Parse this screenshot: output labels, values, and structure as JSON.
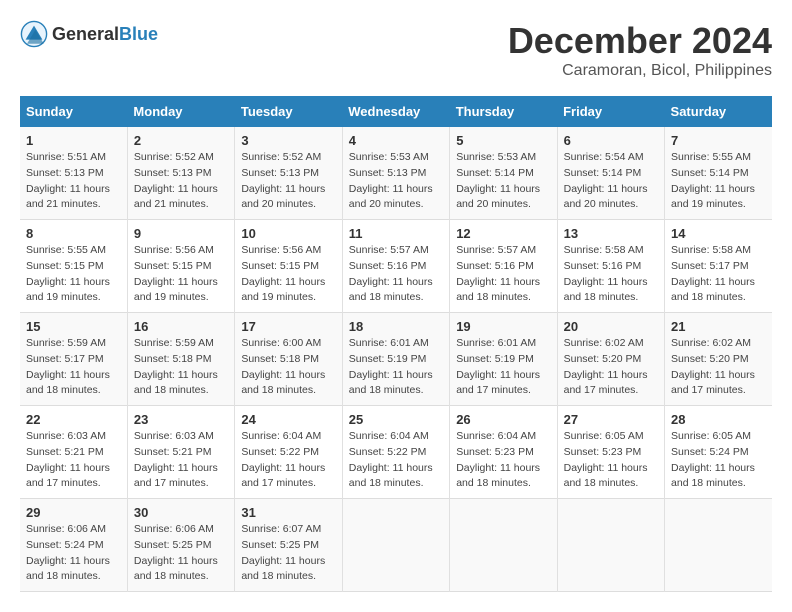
{
  "logo": {
    "text_general": "General",
    "text_blue": "Blue"
  },
  "title": "December 2024",
  "subtitle": "Caramoran, Bicol, Philippines",
  "headers": [
    "Sunday",
    "Monday",
    "Tuesday",
    "Wednesday",
    "Thursday",
    "Friday",
    "Saturday"
  ],
  "weeks": [
    [
      {
        "day": "1",
        "sunrise": "Sunrise: 5:51 AM",
        "sunset": "Sunset: 5:13 PM",
        "daylight": "Daylight: 11 hours and 21 minutes."
      },
      {
        "day": "2",
        "sunrise": "Sunrise: 5:52 AM",
        "sunset": "Sunset: 5:13 PM",
        "daylight": "Daylight: 11 hours and 21 minutes."
      },
      {
        "day": "3",
        "sunrise": "Sunrise: 5:52 AM",
        "sunset": "Sunset: 5:13 PM",
        "daylight": "Daylight: 11 hours and 20 minutes."
      },
      {
        "day": "4",
        "sunrise": "Sunrise: 5:53 AM",
        "sunset": "Sunset: 5:13 PM",
        "daylight": "Daylight: 11 hours and 20 minutes."
      },
      {
        "day": "5",
        "sunrise": "Sunrise: 5:53 AM",
        "sunset": "Sunset: 5:14 PM",
        "daylight": "Daylight: 11 hours and 20 minutes."
      },
      {
        "day": "6",
        "sunrise": "Sunrise: 5:54 AM",
        "sunset": "Sunset: 5:14 PM",
        "daylight": "Daylight: 11 hours and 20 minutes."
      },
      {
        "day": "7",
        "sunrise": "Sunrise: 5:55 AM",
        "sunset": "Sunset: 5:14 PM",
        "daylight": "Daylight: 11 hours and 19 minutes."
      }
    ],
    [
      {
        "day": "8",
        "sunrise": "Sunrise: 5:55 AM",
        "sunset": "Sunset: 5:15 PM",
        "daylight": "Daylight: 11 hours and 19 minutes."
      },
      {
        "day": "9",
        "sunrise": "Sunrise: 5:56 AM",
        "sunset": "Sunset: 5:15 PM",
        "daylight": "Daylight: 11 hours and 19 minutes."
      },
      {
        "day": "10",
        "sunrise": "Sunrise: 5:56 AM",
        "sunset": "Sunset: 5:15 PM",
        "daylight": "Daylight: 11 hours and 19 minutes."
      },
      {
        "day": "11",
        "sunrise": "Sunrise: 5:57 AM",
        "sunset": "Sunset: 5:16 PM",
        "daylight": "Daylight: 11 hours and 18 minutes."
      },
      {
        "day": "12",
        "sunrise": "Sunrise: 5:57 AM",
        "sunset": "Sunset: 5:16 PM",
        "daylight": "Daylight: 11 hours and 18 minutes."
      },
      {
        "day": "13",
        "sunrise": "Sunrise: 5:58 AM",
        "sunset": "Sunset: 5:16 PM",
        "daylight": "Daylight: 11 hours and 18 minutes."
      },
      {
        "day": "14",
        "sunrise": "Sunrise: 5:58 AM",
        "sunset": "Sunset: 5:17 PM",
        "daylight": "Daylight: 11 hours and 18 minutes."
      }
    ],
    [
      {
        "day": "15",
        "sunrise": "Sunrise: 5:59 AM",
        "sunset": "Sunset: 5:17 PM",
        "daylight": "Daylight: 11 hours and 18 minutes."
      },
      {
        "day": "16",
        "sunrise": "Sunrise: 5:59 AM",
        "sunset": "Sunset: 5:18 PM",
        "daylight": "Daylight: 11 hours and 18 minutes."
      },
      {
        "day": "17",
        "sunrise": "Sunrise: 6:00 AM",
        "sunset": "Sunset: 5:18 PM",
        "daylight": "Daylight: 11 hours and 18 minutes."
      },
      {
        "day": "18",
        "sunrise": "Sunrise: 6:01 AM",
        "sunset": "Sunset: 5:19 PM",
        "daylight": "Daylight: 11 hours and 18 minutes."
      },
      {
        "day": "19",
        "sunrise": "Sunrise: 6:01 AM",
        "sunset": "Sunset: 5:19 PM",
        "daylight": "Daylight: 11 hours and 17 minutes."
      },
      {
        "day": "20",
        "sunrise": "Sunrise: 6:02 AM",
        "sunset": "Sunset: 5:20 PM",
        "daylight": "Daylight: 11 hours and 17 minutes."
      },
      {
        "day": "21",
        "sunrise": "Sunrise: 6:02 AM",
        "sunset": "Sunset: 5:20 PM",
        "daylight": "Daylight: 11 hours and 17 minutes."
      }
    ],
    [
      {
        "day": "22",
        "sunrise": "Sunrise: 6:03 AM",
        "sunset": "Sunset: 5:21 PM",
        "daylight": "Daylight: 11 hours and 17 minutes."
      },
      {
        "day": "23",
        "sunrise": "Sunrise: 6:03 AM",
        "sunset": "Sunset: 5:21 PM",
        "daylight": "Daylight: 11 hours and 17 minutes."
      },
      {
        "day": "24",
        "sunrise": "Sunrise: 6:04 AM",
        "sunset": "Sunset: 5:22 PM",
        "daylight": "Daylight: 11 hours and 17 minutes."
      },
      {
        "day": "25",
        "sunrise": "Sunrise: 6:04 AM",
        "sunset": "Sunset: 5:22 PM",
        "daylight": "Daylight: 11 hours and 18 minutes."
      },
      {
        "day": "26",
        "sunrise": "Sunrise: 6:04 AM",
        "sunset": "Sunset: 5:23 PM",
        "daylight": "Daylight: 11 hours and 18 minutes."
      },
      {
        "day": "27",
        "sunrise": "Sunrise: 6:05 AM",
        "sunset": "Sunset: 5:23 PM",
        "daylight": "Daylight: 11 hours and 18 minutes."
      },
      {
        "day": "28",
        "sunrise": "Sunrise: 6:05 AM",
        "sunset": "Sunset: 5:24 PM",
        "daylight": "Daylight: 11 hours and 18 minutes."
      }
    ],
    [
      {
        "day": "29",
        "sunrise": "Sunrise: 6:06 AM",
        "sunset": "Sunset: 5:24 PM",
        "daylight": "Daylight: 11 hours and 18 minutes."
      },
      {
        "day": "30",
        "sunrise": "Sunrise: 6:06 AM",
        "sunset": "Sunset: 5:25 PM",
        "daylight": "Daylight: 11 hours and 18 minutes."
      },
      {
        "day": "31",
        "sunrise": "Sunrise: 6:07 AM",
        "sunset": "Sunset: 5:25 PM",
        "daylight": "Daylight: 11 hours and 18 minutes."
      },
      null,
      null,
      null,
      null
    ]
  ]
}
